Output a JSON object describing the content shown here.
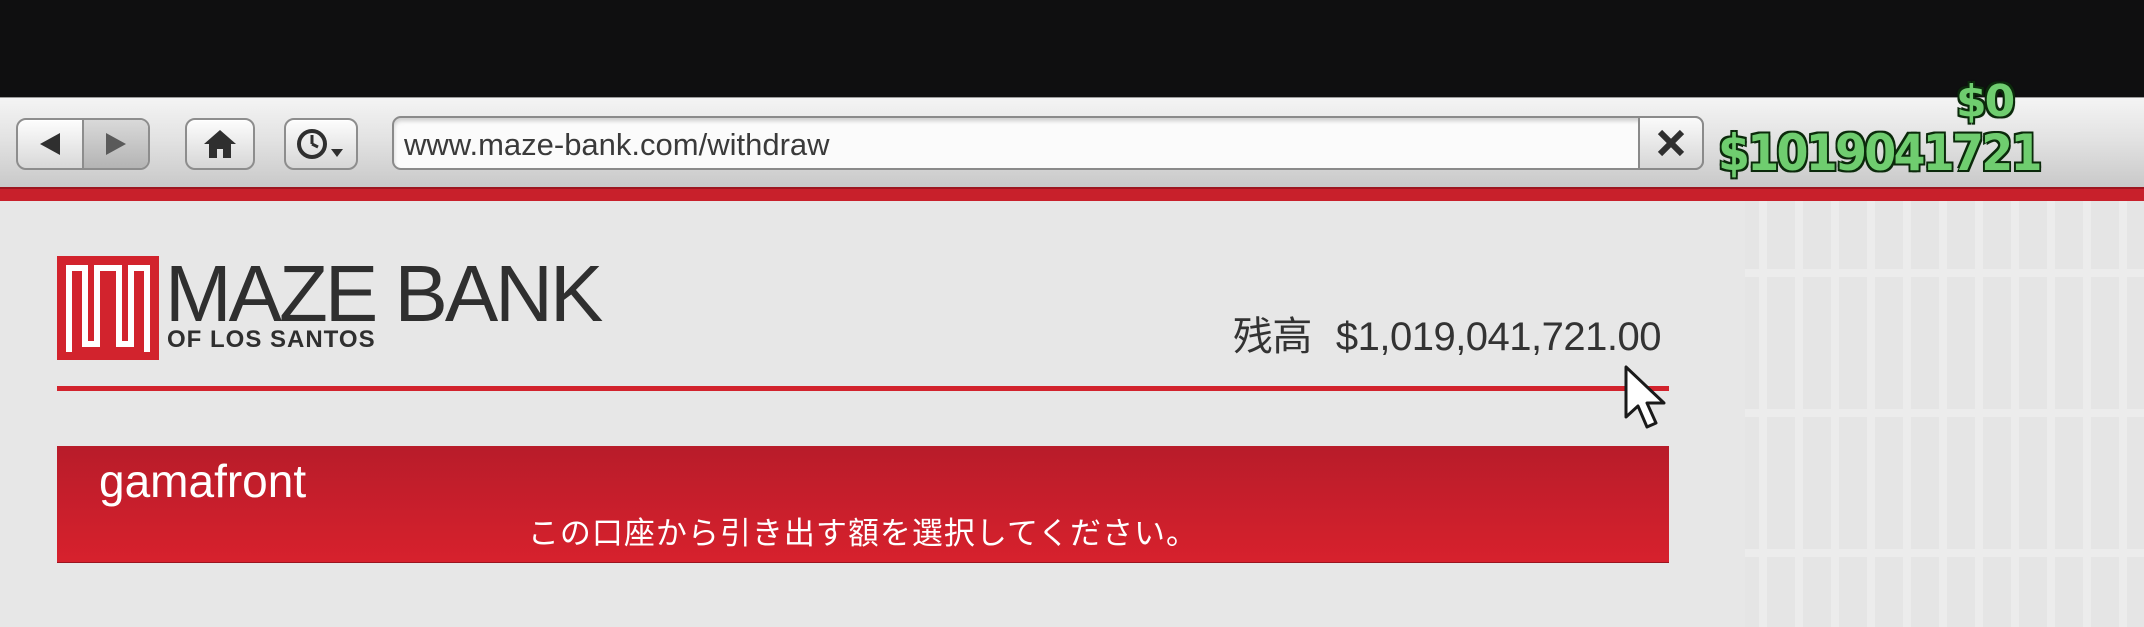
{
  "browser": {
    "url": "www.maze-bank.com/withdraw",
    "buttons": {
      "back_icon": "triangle-left",
      "forward_icon": "triangle-right",
      "home_icon": "house",
      "history_icon": "clock-with-dropdown",
      "clear_icon": "x-mark"
    }
  },
  "hud": {
    "money_change": "$0",
    "money_total": "$1019041721",
    "color": "#6fcd6f"
  },
  "bank": {
    "name": "MAZE BANK",
    "subtitle": "OF LOS SANTOS",
    "balance_label": "残高",
    "balance_value": "$1,019,041,721.00",
    "accent_color": "#d2232d"
  },
  "account": {
    "name": "gamafront",
    "prompt": "この口座から引き出す額を選択してください。"
  }
}
